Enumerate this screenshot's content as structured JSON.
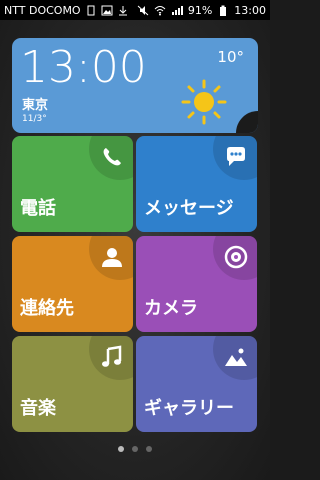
{
  "status": {
    "carrier": "NTT DOCOMO",
    "battery_percent": "91%",
    "time": "13:00",
    "colors": {
      "bar": "#000000"
    },
    "icons": [
      "sim-icon",
      "image-notification-icon",
      "download-icon",
      "mute-icon",
      "wifi-icon",
      "signal-icon",
      "battery-icon"
    ]
  },
  "widget": {
    "time": "13:00",
    "city": "東京",
    "date": "11/3°",
    "temperature": "10°",
    "weather_icon": "sun-icon",
    "color": "#5a9ad6"
  },
  "tiles": [
    {
      "label": "電話",
      "icon": "phone-icon",
      "color": "#4fab4b"
    },
    {
      "label": "メッセージ",
      "icon": "chat-icon",
      "color": "#2f80cc"
    },
    {
      "label": "連絡先",
      "icon": "contact-icon",
      "color": "#d9891f"
    },
    {
      "label": "カメラ",
      "icon": "camera-icon",
      "color": "#9a4fb7"
    },
    {
      "label": "音楽",
      "icon": "music-icon",
      "color": "#8d9143"
    },
    {
      "label": "ギャラリー",
      "icon": "gallery-icon",
      "color": "#5e68b9"
    }
  ],
  "pager": {
    "pages": 3,
    "current": 1
  }
}
